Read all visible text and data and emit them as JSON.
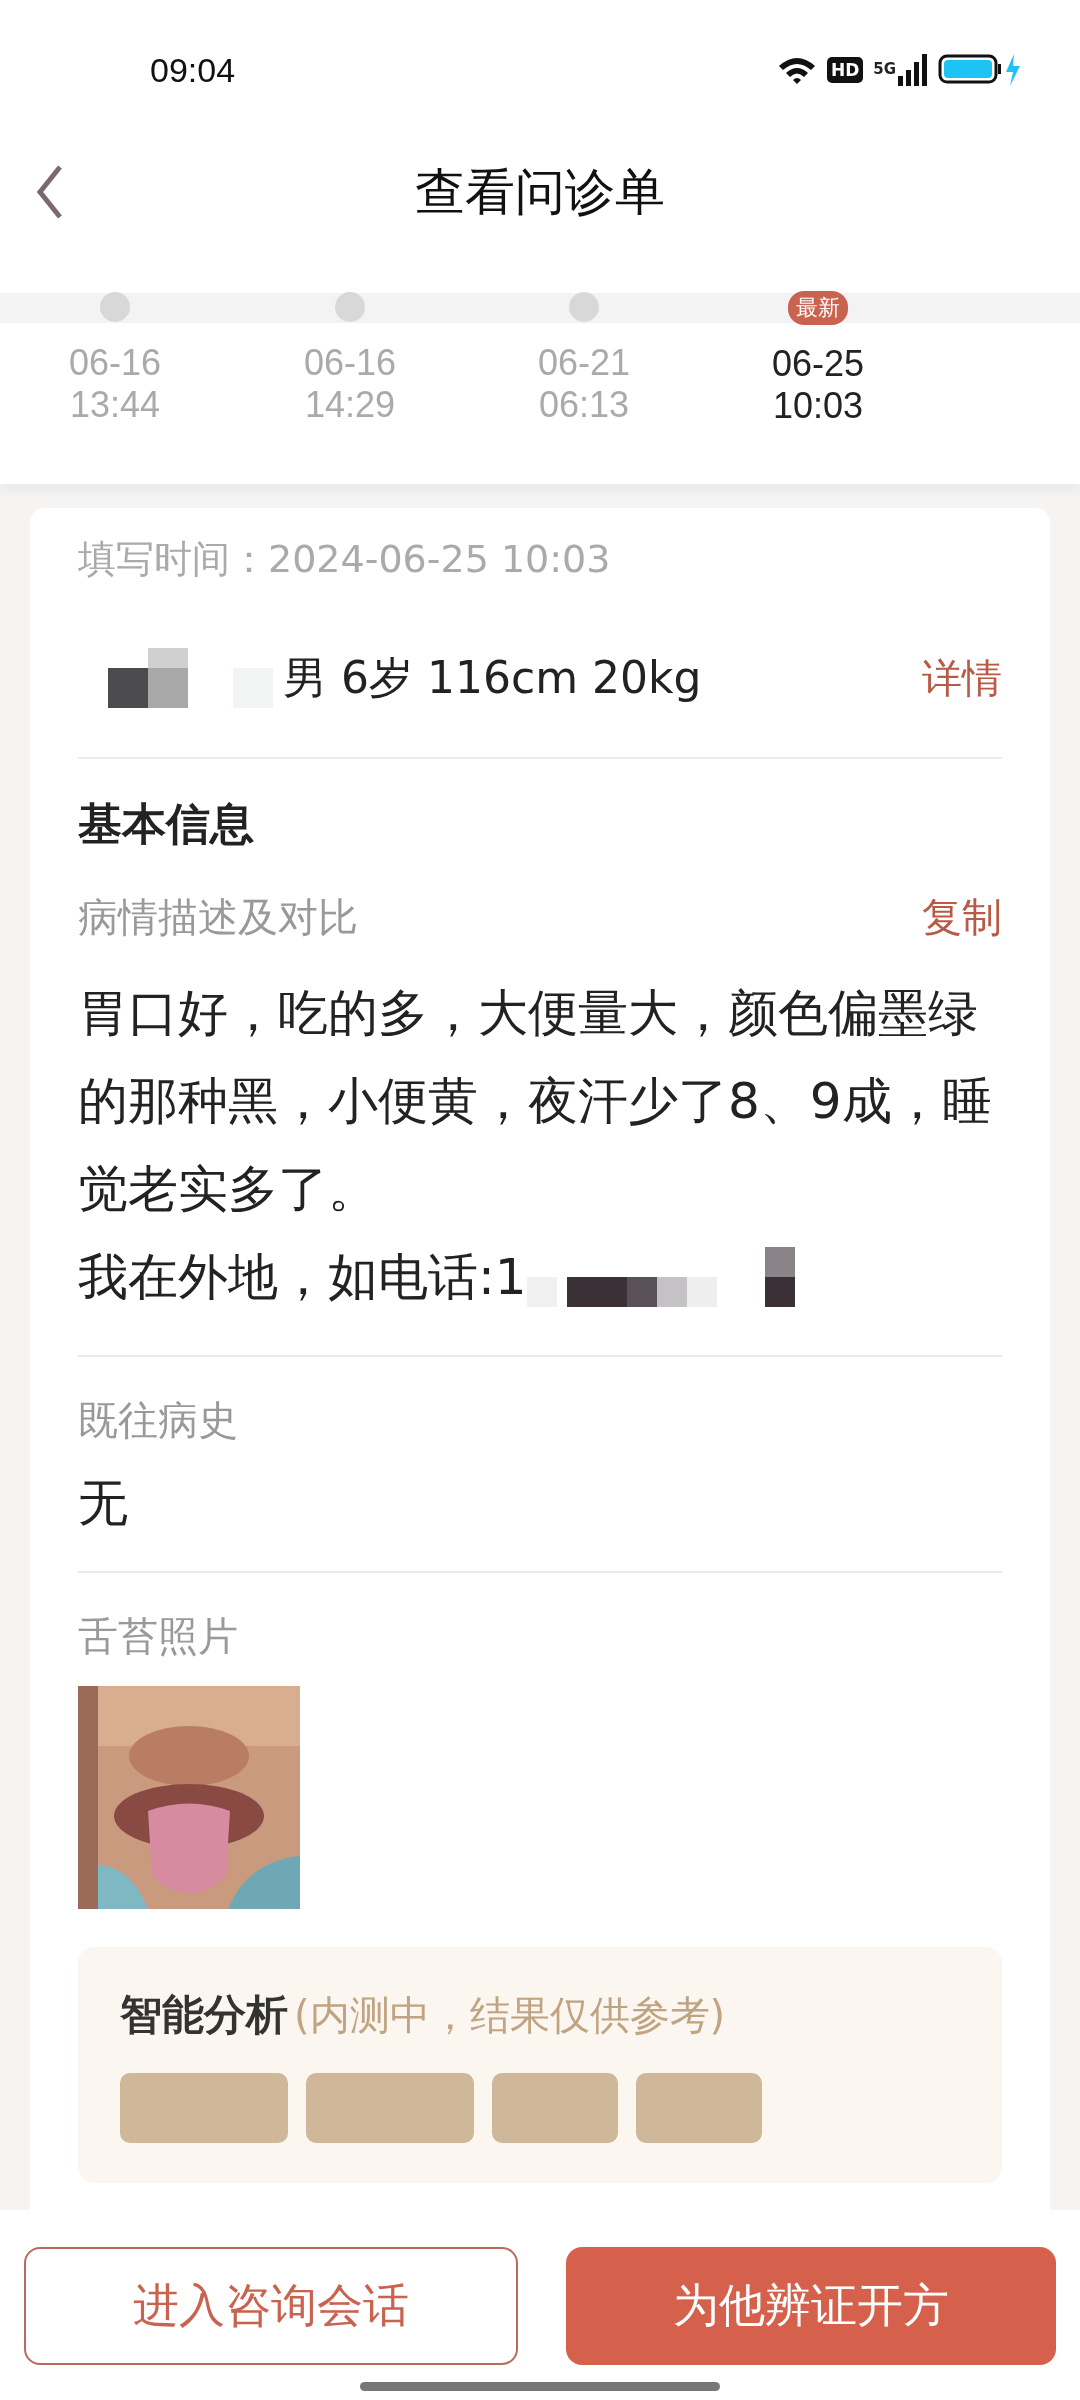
{
  "status_bar": {
    "time": "09:04",
    "hd": "HD",
    "network": "5G"
  },
  "header": {
    "title": "查看问诊单"
  },
  "timeline": [
    {
      "date": "06-16",
      "time": "13:44",
      "selected": false
    },
    {
      "date": "06-16",
      "time": "14:29",
      "selected": false
    },
    {
      "date": "06-21",
      "time": "06:13",
      "selected": false
    },
    {
      "date": "06-25",
      "time": "10:03",
      "selected": true,
      "badge": "最新"
    }
  ],
  "fill_time": {
    "label": "填写时间：",
    "value": "2024-06-25 10:03"
  },
  "patient": {
    "info": "男 6岁 116cm 20kg",
    "link": "详情"
  },
  "section_title": "基本信息",
  "description": {
    "label": "病情描述及对比",
    "action": "复制",
    "text": "胃口好，吃的多，大便量大，颜色偏墨绿的那种黑，小便黄，夜汗少了8、9成，睡觉老实多了。",
    "contact": "我在外地，如电话:1"
  },
  "history": {
    "label": "既往病史",
    "value": "无"
  },
  "tongue_photo": {
    "label": "舌苔照片",
    "kind": "picture"
  },
  "analysis": {
    "title": "智能分析",
    "note": "(内测中，结果仅供参考)"
  },
  "buttons": [
    {
      "label": "进入咨询会话",
      "kind": "outline"
    },
    {
      "label": "为他辨证开方",
      "kind": "primary"
    }
  ]
}
